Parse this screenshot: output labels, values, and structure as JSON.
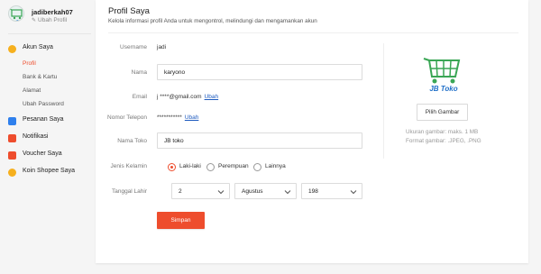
{
  "sidebar": {
    "username": "jadiberkah07",
    "edit_profile": "Ubah Profil",
    "account": {
      "label": "Akun Saya",
      "items": [
        {
          "label": "Profil",
          "active": true
        },
        {
          "label": "Bank & Kartu",
          "active": false
        },
        {
          "label": "Alamat",
          "active": false
        },
        {
          "label": "Ubah Password",
          "active": false
        }
      ]
    },
    "menu": [
      {
        "label": "Pesanan Saya",
        "icon": "clipboard-icon",
        "color": "#2f80ed"
      },
      {
        "label": "Notifikasi",
        "icon": "bell-icon",
        "color": "#ee4d2d"
      },
      {
        "label": "Voucher Saya",
        "icon": "ticket-icon",
        "color": "#ee4d2d"
      },
      {
        "label": "Koin Shopee Saya",
        "icon": "coin-icon",
        "color": "#f6b01e"
      }
    ]
  },
  "profile": {
    "title": "Profil Saya",
    "subtitle": "Kelola informasi profil Anda untuk mengontrol, melindungi dan mengamankan akun",
    "username_label": "Username",
    "username_value": "jadi",
    "name_label": "Nama",
    "name_value": "karyono",
    "email_label": "Email",
    "email_value": "j ****@gmail.com",
    "email_change": "Ubah",
    "phone_label": "Nomor Telepon",
    "phone_value": "***********",
    "phone_change": "Ubah",
    "shop_label": "Nama Toko",
    "shop_value": "JB toko",
    "gender_label": "Jenis Kelamin",
    "gender_options": [
      "Laki-laki",
      "Perempuan",
      "Lainnya"
    ],
    "gender_selected": "Laki-laki",
    "birth_label": "Tanggal Lahir",
    "birth_day": "2",
    "birth_month": "Agustus",
    "birth_year": "198",
    "save": "Simpan"
  },
  "image_panel": {
    "logo_text": "JB Toko",
    "pick_button": "Pilih Gambar",
    "hint_size": "Ukuran gambar: maks. 1 MB",
    "hint_format": "Format gambar: .JPEG, .PNG"
  },
  "colors": {
    "accent": "#ee4d2d",
    "link": "#1e5bbf",
    "logo_green": "#3aa655",
    "logo_blue": "#1f6fc8"
  }
}
